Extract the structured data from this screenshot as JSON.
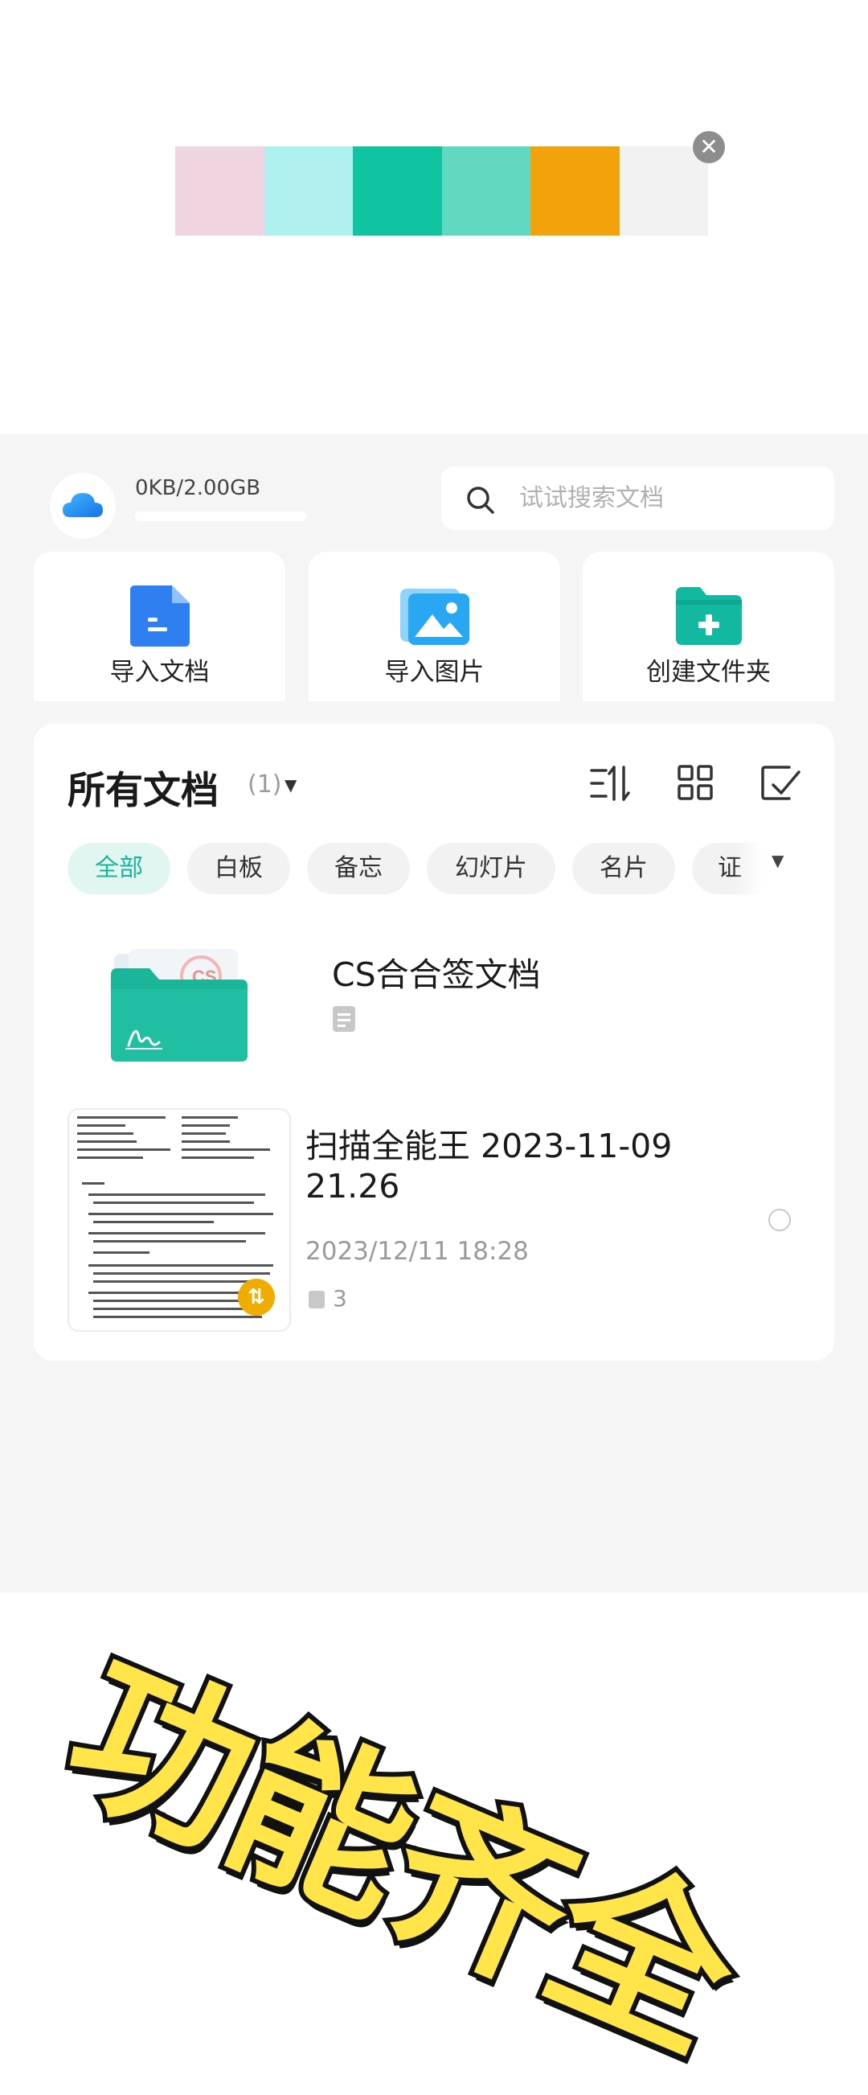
{
  "banner": {
    "swatches": [
      "#f0d4df",
      "#aef1ef",
      "#10c4a1",
      "#61d8c0",
      "#f2a20b",
      "#f2f2f2"
    ],
    "close_icon": "close-icon"
  },
  "storage": {
    "text": "0KB/2.00GB",
    "used_fraction": 0,
    "icon": "cloud-icon"
  },
  "search": {
    "placeholder": "试试搜索文档",
    "icon": "search-icon"
  },
  "actions": [
    {
      "label": "导入文档",
      "icon": "document-icon"
    },
    {
      "label": "导入图片",
      "icon": "image-icon"
    },
    {
      "label": "创建文件夹",
      "icon": "folder-add-icon"
    }
  ],
  "docs": {
    "title": "所有文档",
    "count": "(1)",
    "toolbar_icons": [
      "sort-icon",
      "grid-view-icon",
      "multi-select-icon"
    ]
  },
  "chips": [
    "全部",
    "白板",
    "备忘",
    "幻灯片",
    "名片",
    "证"
  ],
  "folder": {
    "title": "CS合合签文档",
    "stamp_text": "CS"
  },
  "document": {
    "title": "扫描全能王 2023-11-09 21.26",
    "date": "2023/12/11 18:28",
    "pages": "3",
    "sync_icon": "sync-icon"
  },
  "promo": {
    "text": "功能齐全"
  },
  "colors": {
    "accent": "#19b29a",
    "blue_icon": "#2f7ff0",
    "teal_icon": "#12b8a0",
    "badge": "#f0ad00",
    "promo_yellow": "#ffe44a"
  }
}
